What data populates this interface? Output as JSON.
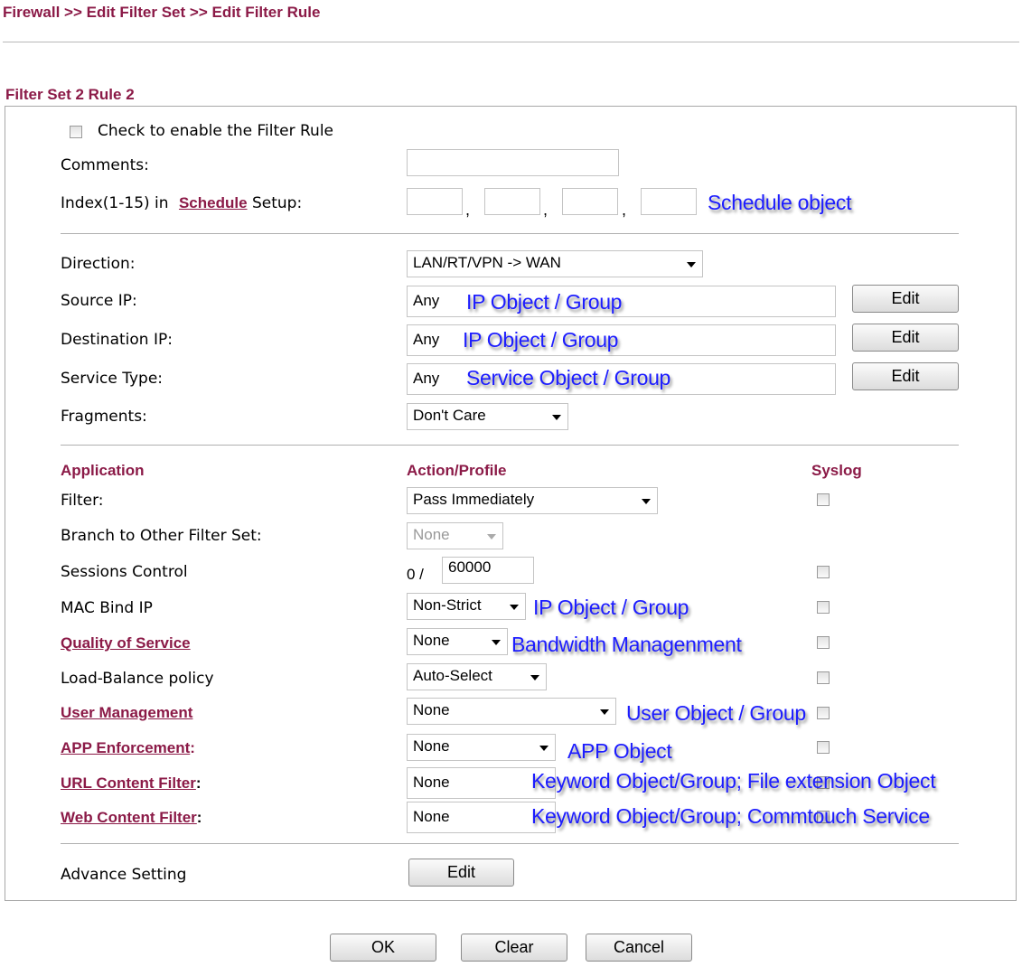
{
  "breadcrumb": "Firewall >> Edit Filter Set >> Edit Filter Rule",
  "title": "Filter Set 2 Rule 2",
  "enable_label": "Check to enable the Filter Rule",
  "comments_label": "Comments:",
  "schedule": {
    "prefix": "Index(1-15) in",
    "link": "Schedule",
    "suffix": "Setup:",
    "note": "Schedule object"
  },
  "direction": {
    "label": "Direction:",
    "value": "LAN/RT/VPN -> WAN"
  },
  "source_ip": {
    "label": "Source IP:",
    "value": "Any",
    "note": "IP Object / Group",
    "button": "Edit"
  },
  "destination_ip": {
    "label": "Destination IP:",
    "value": "Any",
    "note": "IP Object / Group",
    "button": "Edit"
  },
  "service_type": {
    "label": "Service Type:",
    "value": "Any",
    "note": "Service Object / Group",
    "button": "Edit"
  },
  "fragments": {
    "label": "Fragments:",
    "value": "Don't Care"
  },
  "headers": {
    "application": "Application",
    "action": "Action/Profile",
    "syslog": "Syslog"
  },
  "filter": {
    "label": "Filter:",
    "value": "Pass Immediately"
  },
  "branch": {
    "label": "Branch to Other Filter Set:",
    "value": "None"
  },
  "sessions": {
    "label": "Sessions Control",
    "current": "0 /",
    "value": "60000"
  },
  "mac_bind": {
    "label": "MAC Bind IP",
    "value": "Non-Strict",
    "note": "IP Object / Group"
  },
  "qos": {
    "label": "Quality of Service",
    "value": "None",
    "note": "Bandwidth Managenment"
  },
  "load_balance": {
    "label": "Load-Balance policy",
    "value": "Auto-Select"
  },
  "user_mgmt": {
    "label": "User Management",
    "value": "None",
    "note": "User Object / Group"
  },
  "app_enf": {
    "label": "APP Enforcement",
    "colon": ":",
    "value": "None",
    "note": "APP Object"
  },
  "url_filter": {
    "label": "URL Content Filter",
    "colon": ":",
    "value": "None",
    "note": "Keyword Object/Group; File extension Object"
  },
  "web_filter": {
    "label": "Web Content Filter",
    "colon": ":",
    "value": "None",
    "note": "Keyword Object/Group; Commtouch Service"
  },
  "advance": {
    "label": "Advance Setting",
    "button": "Edit"
  },
  "buttons": {
    "ok": "OK",
    "clear": "Clear",
    "cancel": "Cancel"
  }
}
